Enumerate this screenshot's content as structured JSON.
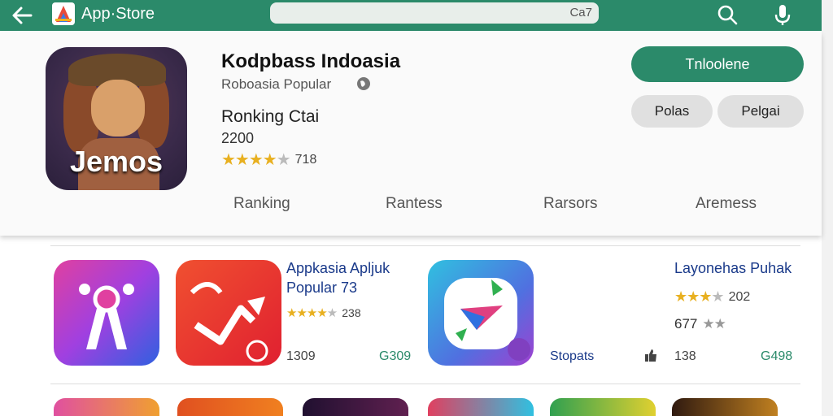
{
  "topbar": {
    "title": "App·Store",
    "search_text": "Ca7",
    "back_icon": "back-arrow-icon",
    "search_icon": "search-icon",
    "mic_icon": "microphone-icon",
    "bar_color": "#2b8a6a"
  },
  "header": {
    "icon_word": "Jemos",
    "app_name": "Kodpbass Indoasia",
    "subtitle": "Roboasia Popular",
    "ranking_label": "Ronking Ctai",
    "ranking_value": "2200",
    "rating_count": "718",
    "rating_stars": 4.5,
    "install_label": "Tnloolene",
    "pill_a_label": "Polas",
    "pill_b_label": "Pelgai"
  },
  "tabs": [
    "Ranking",
    "Rantess",
    "Rarsors",
    "Aremess"
  ],
  "list": {
    "item1": {
      "title_line1": "Appkasia Apljuk",
      "title_line2": "Popular 73",
      "rating_count": "238",
      "meta_left": "1309",
      "meta_right": "G309"
    },
    "item2": {
      "title": "Layonehas Puhak",
      "rating_count": "202",
      "sub_value": "677",
      "meta_label": "Stopats",
      "meta_left": "138",
      "meta_right": "G498"
    }
  },
  "colors": {
    "accent": "#2b8a6a",
    "star": "#e8b020",
    "link": "#1a3a8a"
  }
}
